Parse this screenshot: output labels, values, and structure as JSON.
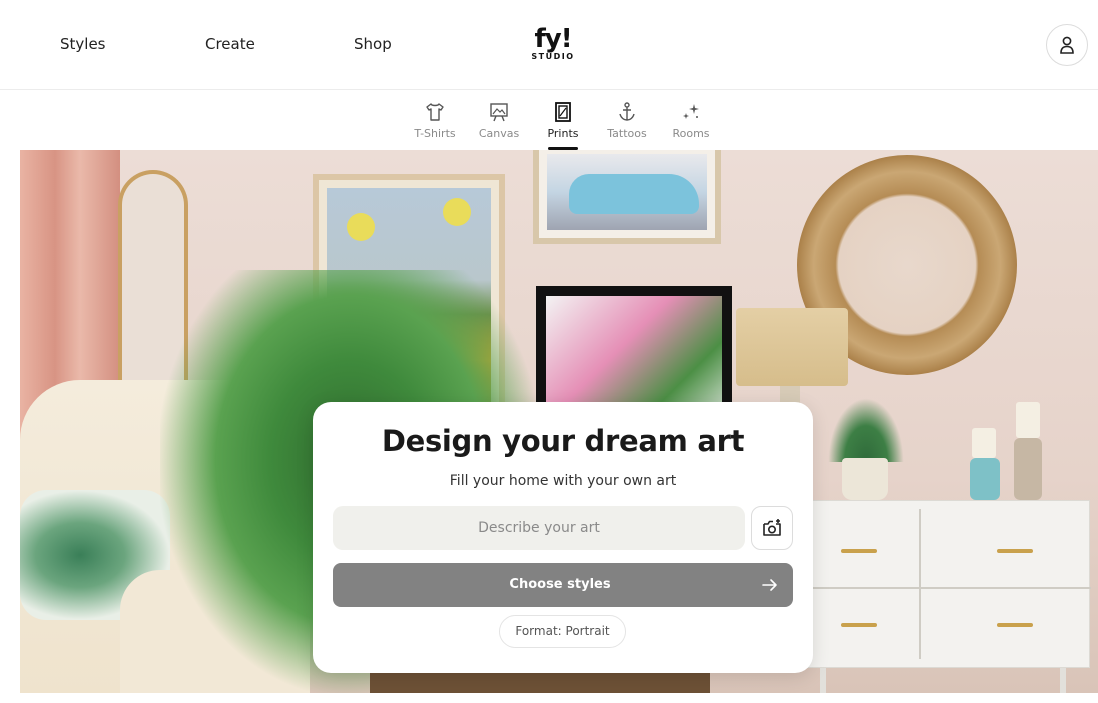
{
  "topnav": {
    "links": [
      {
        "label": "Styles"
      },
      {
        "label": "Create"
      },
      {
        "label": "Shop"
      }
    ],
    "logo": {
      "main": "fy!",
      "sub": "STUDIO"
    },
    "account_icon": "user-icon"
  },
  "categories": [
    {
      "label": "T-Shirts",
      "icon": "tshirt-icon",
      "active": false
    },
    {
      "label": "Canvas",
      "icon": "canvas-icon",
      "active": false
    },
    {
      "label": "Prints",
      "icon": "print-frame-icon",
      "active": true
    },
    {
      "label": "Tattoos",
      "icon": "anchor-icon",
      "active": false
    },
    {
      "label": "Rooms",
      "icon": "sparkles-icon",
      "active": false
    }
  ],
  "card": {
    "title": "Design your dream art",
    "subtitle": "Fill your home with your own art",
    "input_placeholder": "Describe your art",
    "input_value": "",
    "camera_icon": "add-photo-icon",
    "choose_label": "Choose styles",
    "arrow_icon": "arrow-right-icon",
    "format_label": "Format: Portrait"
  },
  "colors": {
    "accent_button": "#828282",
    "input_bg": "#f0f0ec",
    "text_primary": "#1a1a1a"
  }
}
